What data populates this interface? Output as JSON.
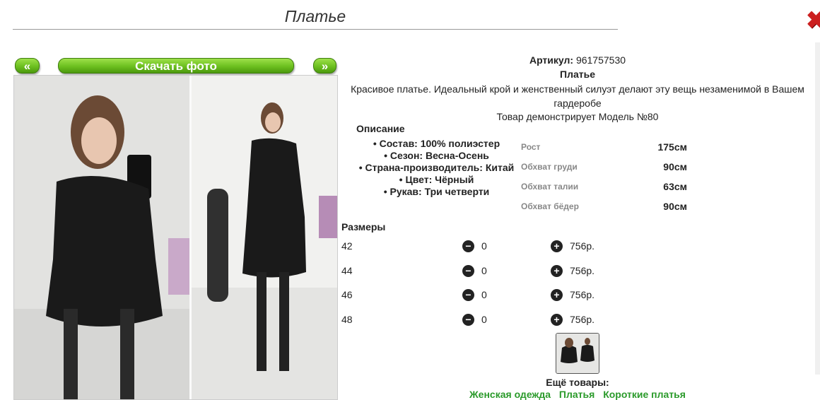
{
  "title": "Платье",
  "nav": {
    "prev": "«",
    "next": "»",
    "download": "Скачать фото"
  },
  "product": {
    "article_label": "Артикул:",
    "article": "961757530",
    "name": "Платье",
    "description": "Красивое платье. Идеальный крой и женственный силуэт делают эту вещь незаменимой в Вашем гардеробе",
    "model_line": "Товар демонстрирует Модель №80"
  },
  "description_heading": "Описание",
  "features": [
    "Состав: 100% полиэстер",
    "Сезон: Весна-Осень",
    "Страна-производитель: Китай",
    "Цвет: Чёрный",
    "Рукав: Три четверти"
  ],
  "measurements": [
    {
      "label": "Рост",
      "value": "175см"
    },
    {
      "label": "Обхват груди",
      "value": "90см"
    },
    {
      "label": "Обхват талии",
      "value": "63см"
    },
    {
      "label": "Обхват бёдер",
      "value": "90см"
    }
  ],
  "sizes_heading": "Размеры",
  "sizes": [
    {
      "size": "42",
      "qty": "0",
      "price": "756р."
    },
    {
      "size": "44",
      "qty": "0",
      "price": "756р."
    },
    {
      "size": "46",
      "qty": "0",
      "price": "756р."
    },
    {
      "size": "48",
      "qty": "0",
      "price": "756р."
    }
  ],
  "more_label": "Ещё товары:",
  "breadcrumbs": [
    "Женская одежда",
    "Платья",
    "Короткие платья"
  ],
  "icons": {
    "close": "close-icon",
    "minus": "minus-circle-icon",
    "plus": "plus-circle-icon"
  },
  "colors": {
    "button_green": "#6cbf1f",
    "close_red": "#cc1f1f",
    "link_green": "#2a9a2a"
  }
}
